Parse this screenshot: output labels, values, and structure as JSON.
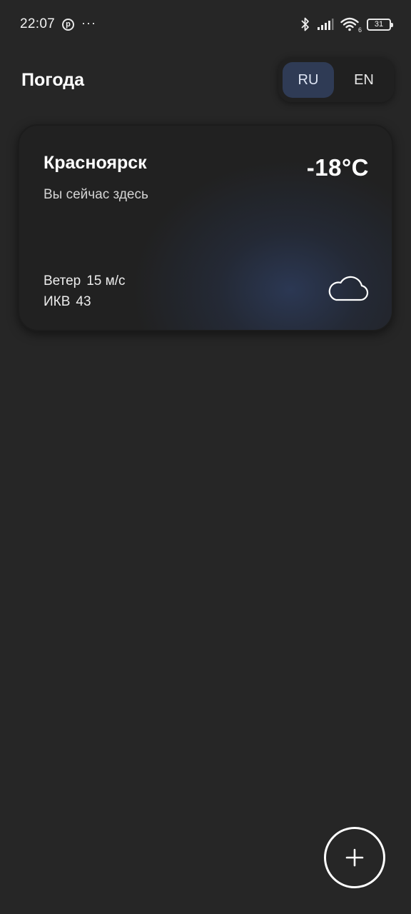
{
  "status_bar": {
    "time": "22:07",
    "battery": "31",
    "network_badge": "6",
    "icons": [
      "pinterest-icon",
      "more-dots-icon",
      "bluetooth-icon",
      "signal-icon",
      "wifi-icon",
      "battery-icon"
    ]
  },
  "header": {
    "title": "Погода",
    "languages": [
      {
        "label": "RU",
        "active": true
      },
      {
        "label": "EN",
        "active": false
      }
    ]
  },
  "card": {
    "city": "Красноярск",
    "temperature": "-18°C",
    "note": "Вы сейчас здесь",
    "wind_label": "Ветер",
    "wind_value": "15 м/с",
    "aqi_label": "ИКВ",
    "aqi_value": "43",
    "condition_icon": "cloud-icon"
  },
  "fab": {
    "icon": "plus-icon"
  },
  "colors": {
    "background": "#262626",
    "card": "#212121",
    "accent": "#2f3b55",
    "text": "#ffffff"
  }
}
